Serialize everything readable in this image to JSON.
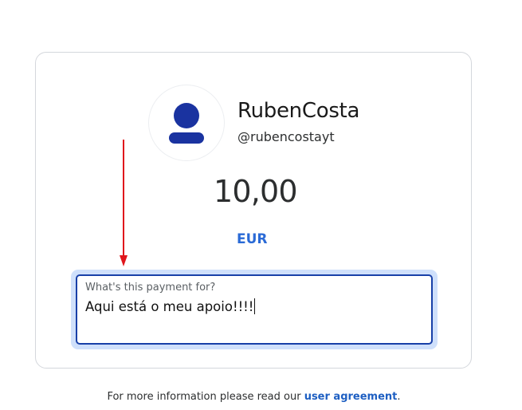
{
  "profile": {
    "name": "RubenCosta",
    "handle": "@rubencostayt",
    "avatar_icon": "user-silhouette-icon"
  },
  "payment": {
    "amount": "10,00",
    "currency": "EUR"
  },
  "note": {
    "label": "What's this payment for?",
    "value": "Aqui está o meu apoio!!!!"
  },
  "footer": {
    "text_before": "For more information please read our ",
    "link_label": "user agreement",
    "text_after": "."
  },
  "annotation": {
    "arrow_icon": "red-down-arrow-icon"
  },
  "colors": {
    "accent": "#2a6ad6",
    "focus_border": "#1840a8",
    "focus_ring": "#cfe0fb",
    "avatar": "#1a33a0",
    "arrow": "#e0161c",
    "link": "#1e5fc2"
  }
}
